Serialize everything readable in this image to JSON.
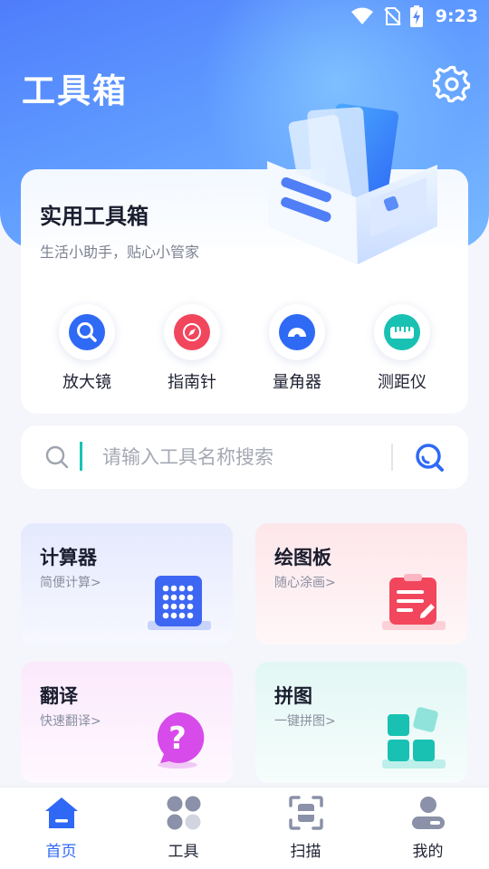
{
  "status_bar": {
    "time": "9:23"
  },
  "header": {
    "title": "工具箱"
  },
  "hero_card": {
    "title": "实用工具箱",
    "subtitle": "生活小助手，贴心小管家"
  },
  "quick_tools": [
    {
      "label": "放大镜",
      "icon": "magnifier-icon",
      "color": "#2f6af5"
    },
    {
      "label": "指南针",
      "icon": "compass-icon",
      "color": "#f2465d"
    },
    {
      "label": "量角器",
      "icon": "protractor-icon",
      "color": "#2f6af5"
    },
    {
      "label": "测距仪",
      "icon": "ruler-icon",
      "color": "#19c1b3"
    }
  ],
  "search": {
    "placeholder": "请输入工具名称搜索"
  },
  "tiles": [
    {
      "title": "计算器",
      "subtitle": "简便计算>",
      "icon": "calculator-icon"
    },
    {
      "title": "绘图板",
      "subtitle": "随心涂画>",
      "icon": "drawing-board-icon"
    },
    {
      "title": "翻译",
      "subtitle": "快速翻译>",
      "icon": "question-bubble-icon"
    },
    {
      "title": "拼图",
      "subtitle": "一键拼图>",
      "icon": "puzzle-blocks-icon"
    }
  ],
  "bottom_nav": [
    {
      "label": "首页",
      "icon": "home-icon",
      "active": true
    },
    {
      "label": "工具",
      "icon": "tools-grid-icon",
      "active": false
    },
    {
      "label": "扫描",
      "icon": "scan-icon",
      "active": false
    },
    {
      "label": "我的",
      "icon": "profile-icon",
      "active": false
    }
  ],
  "colors": {
    "accent": "#2f68f5",
    "teal": "#17c3b6",
    "pink": "#f2465d"
  }
}
